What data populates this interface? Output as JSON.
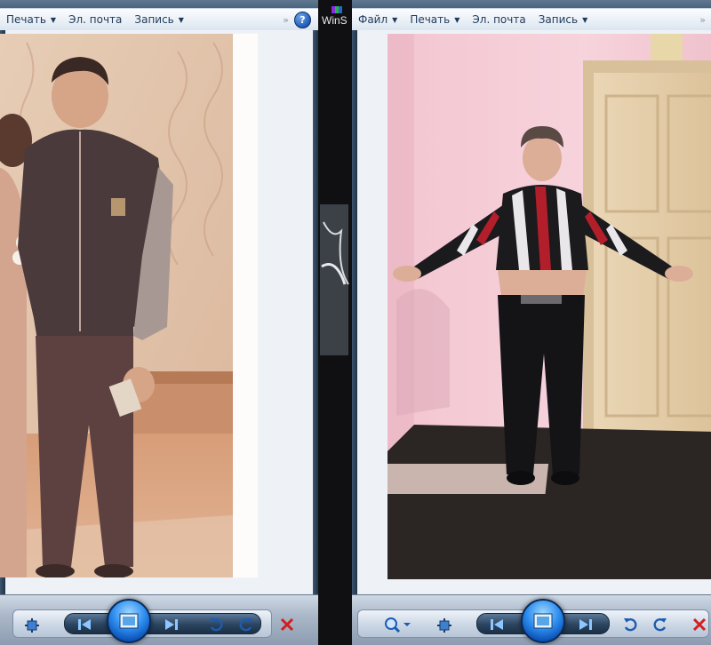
{
  "left_window": {
    "menu": [
      {
        "label": "Печать"
      },
      {
        "label": "Эл. почта"
      },
      {
        "label": "Запись"
      }
    ],
    "overflow_glyph": "»",
    "help_glyph": "?",
    "icons": [
      "fit-icon",
      "previous-icon",
      "slideshow-icon",
      "next-icon",
      "rotate-left-icon",
      "rotate-right-icon",
      "delete-icon"
    ]
  },
  "right_window": {
    "menu": [
      {
        "label": "Файл"
      },
      {
        "label": "Печать"
      },
      {
        "label": "Эл. почта"
      },
      {
        "label": "Запись"
      }
    ],
    "overflow_glyph": "»",
    "icons": [
      "zoom-icon",
      "fit-icon",
      "previous-icon",
      "slideshow-icon",
      "next-icon",
      "rotate-left-icon",
      "rotate-right-icon",
      "delete-icon"
    ]
  },
  "background_label": "WinS",
  "colors": {
    "accent_blue": "#1f5cb7",
    "delete_red": "#d21f1f",
    "menu_text": "#1e395b"
  }
}
